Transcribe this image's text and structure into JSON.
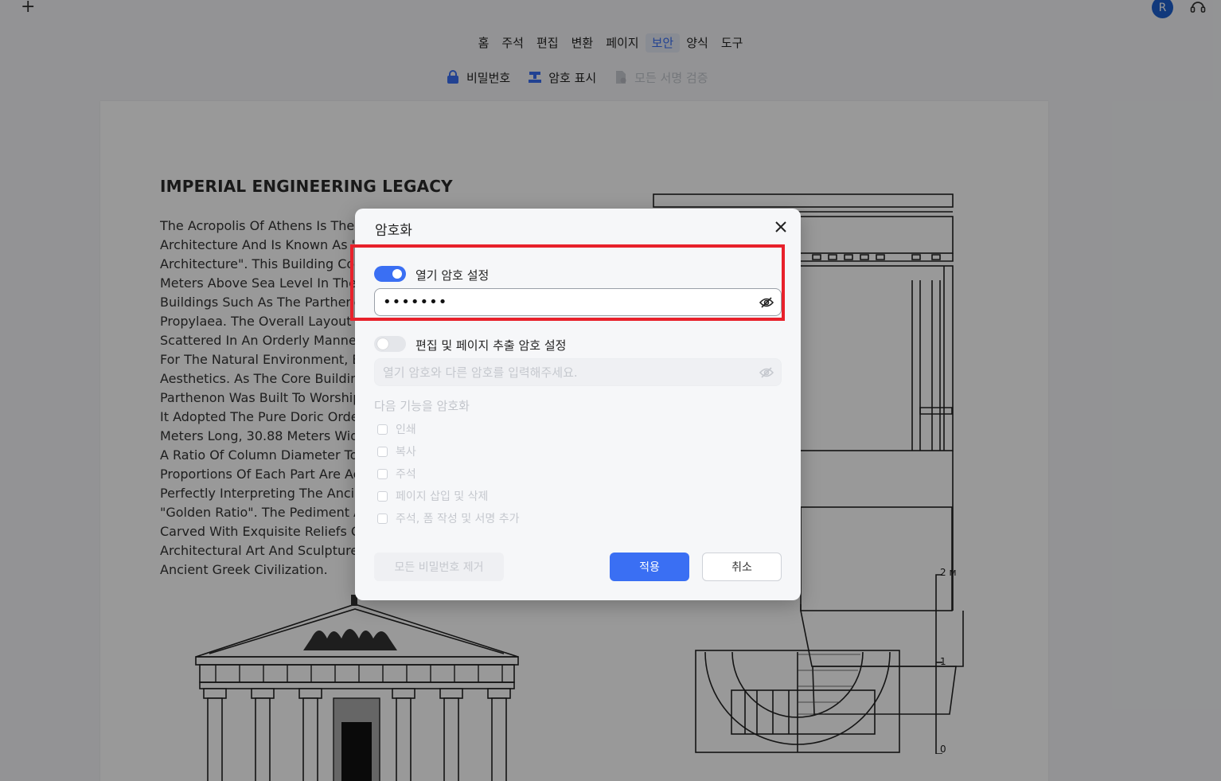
{
  "topbar": {
    "plus_label": "+",
    "avatar_letter": "R"
  },
  "menu": {
    "items": [
      "홈",
      "주석",
      "편집",
      "변환",
      "페이지",
      "보안",
      "양식",
      "도구"
    ],
    "active": "보안"
  },
  "subtoolbar": {
    "password_label": "비밀번호",
    "redact_label": "암호 표시",
    "verify_label": "모든 서명 검증"
  },
  "document": {
    "title": "IMPERIAL ENGINEERING LEGACY",
    "lines": [
      "The Acropolis Of Athens Is The P",
      "Architecture And Is Known As \"T",
      "Architecture\". This Building Com",
      "Meters Above Sea Level In The S",
      "Buildings Such As The Parthenon",
      "Propylaea. The Overall Layout O",
      "Scattered In An Orderly Manner,",
      "For The Natural Environment, Bu",
      "Aesthetics. As The Core Building",
      "Parthenon Was Built To Worship",
      "It Adopted The Pure Doric Order",
      "Meters Long, 30.88 Meters Wide",
      "A Ratio Of Column Diameter To",
      "Proportions Of Each Part Are Ac",
      "Perfectly Interpreting The Ancie",
      "\"Golden Ratio\". The Pediment An",
      "Carved With Exquisite Reliefs O",
      "Architectural Art And Sculpture",
      "Ancient Greek Civilization."
    ],
    "scale_labels": [
      "2 м",
      "1",
      "0"
    ]
  },
  "dialog": {
    "title": "암호화",
    "open_password": {
      "label": "열기 암호 설정",
      "enabled": true,
      "value": "•••••••"
    },
    "edit_password": {
      "label": "편집 및 페이지 추출 암호 설정",
      "enabled": false,
      "placeholder": "열기 암호와 다른 암호를 입력해주세요."
    },
    "encrypt_features": {
      "label": "다음 기능을 암호화",
      "options": [
        "인쇄",
        "복사",
        "주석",
        "페이지 삽입 및 삭제",
        "주석, 폼 작성 및 서명 추가"
      ]
    },
    "remove_all_label": "모든 비밀번호 제거",
    "apply_label": "적용",
    "cancel_label": "취소"
  },
  "colors": {
    "accent": "#3a6ff3",
    "highlight": "#e8212b",
    "avatar": "#1d5fcf"
  }
}
